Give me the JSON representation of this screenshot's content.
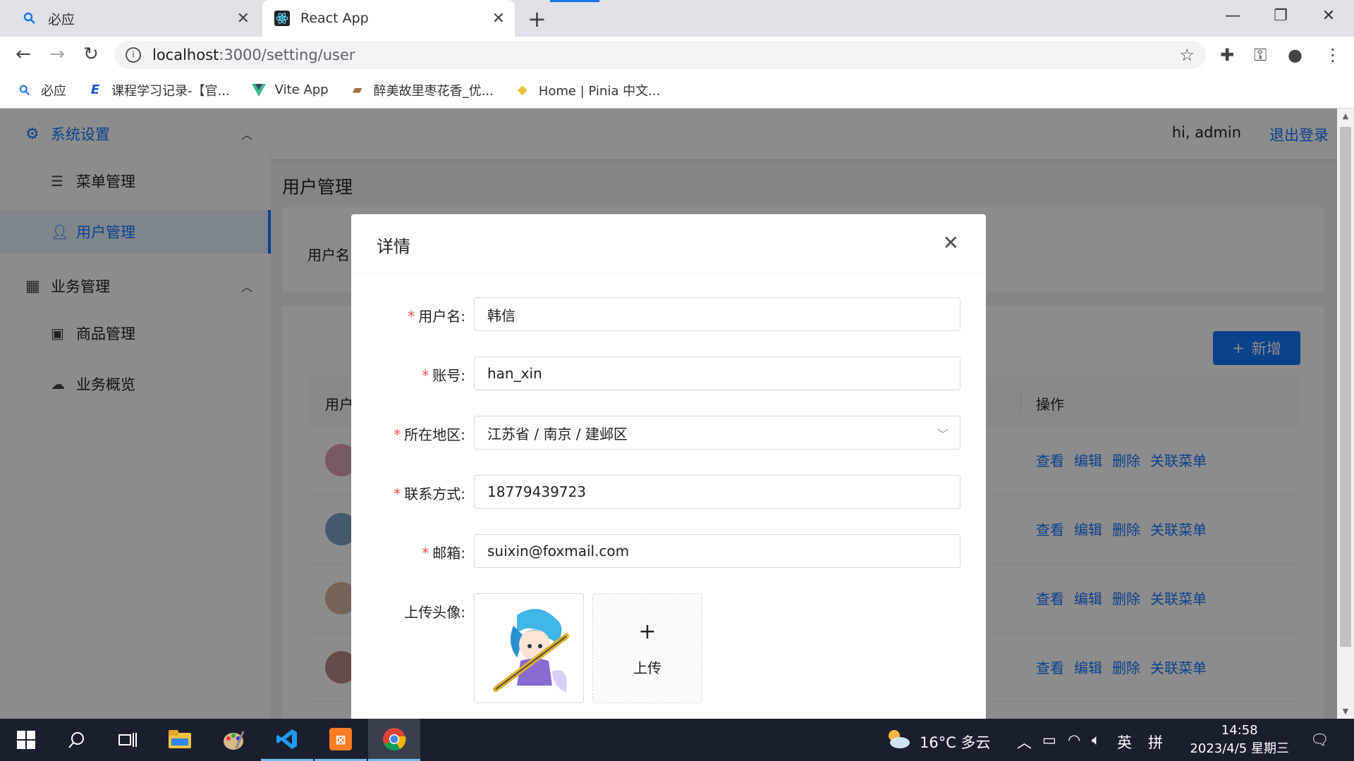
{
  "browser": {
    "tabs": [
      {
        "title": "必应"
      },
      {
        "title": "React App"
      }
    ],
    "url_host": "localhost",
    "url_path": ":3000/setting/user",
    "bookmarks": [
      {
        "label": "必应"
      },
      {
        "label": "课程学习记录-【官..."
      },
      {
        "label": "Vite App"
      },
      {
        "label": "醉美故里枣花香_优..."
      },
      {
        "label": "Home | Pinia 中文..."
      }
    ]
  },
  "sidebar": {
    "groups": [
      {
        "label": "系统设置",
        "items": [
          {
            "label": "菜单管理"
          },
          {
            "label": "用户管理"
          }
        ]
      },
      {
        "label": "业务管理",
        "items": [
          {
            "label": "商品管理"
          },
          {
            "label": "业务概览"
          }
        ]
      }
    ]
  },
  "header": {
    "greeting": "hi, admin",
    "logout": "退出登录"
  },
  "page": {
    "title": "用户管理",
    "search_label": "用户名",
    "add_button": "新增",
    "table": {
      "col_first": "用户",
      "col_actions": "操作",
      "actions": [
        "查看",
        "编辑",
        "删除",
        "关联菜单"
      ],
      "row_count": 4
    }
  },
  "modal": {
    "title": "详情",
    "fields": {
      "username": {
        "label": "用户名",
        "value": "韩信"
      },
      "account": {
        "label": "账号",
        "value": "han_xin"
      },
      "region": {
        "label": "所在地区",
        "value": "江苏省 / 南京 / 建邺区"
      },
      "phone": {
        "label": "联系方式",
        "value": "18779439723"
      },
      "email": {
        "label": "邮箱",
        "value": "suixin@foxmail.com"
      },
      "avatar": {
        "label": "上传头像"
      }
    },
    "upload_label": "上传"
  },
  "taskbar": {
    "weather": "16°C 多云",
    "ime_lang": "英",
    "ime_mode": "拼",
    "time": "14:58",
    "date": "2023/4/5 星期三"
  },
  "colors": {
    "primary": "#1677ff",
    "required": "#ff4d4f"
  }
}
